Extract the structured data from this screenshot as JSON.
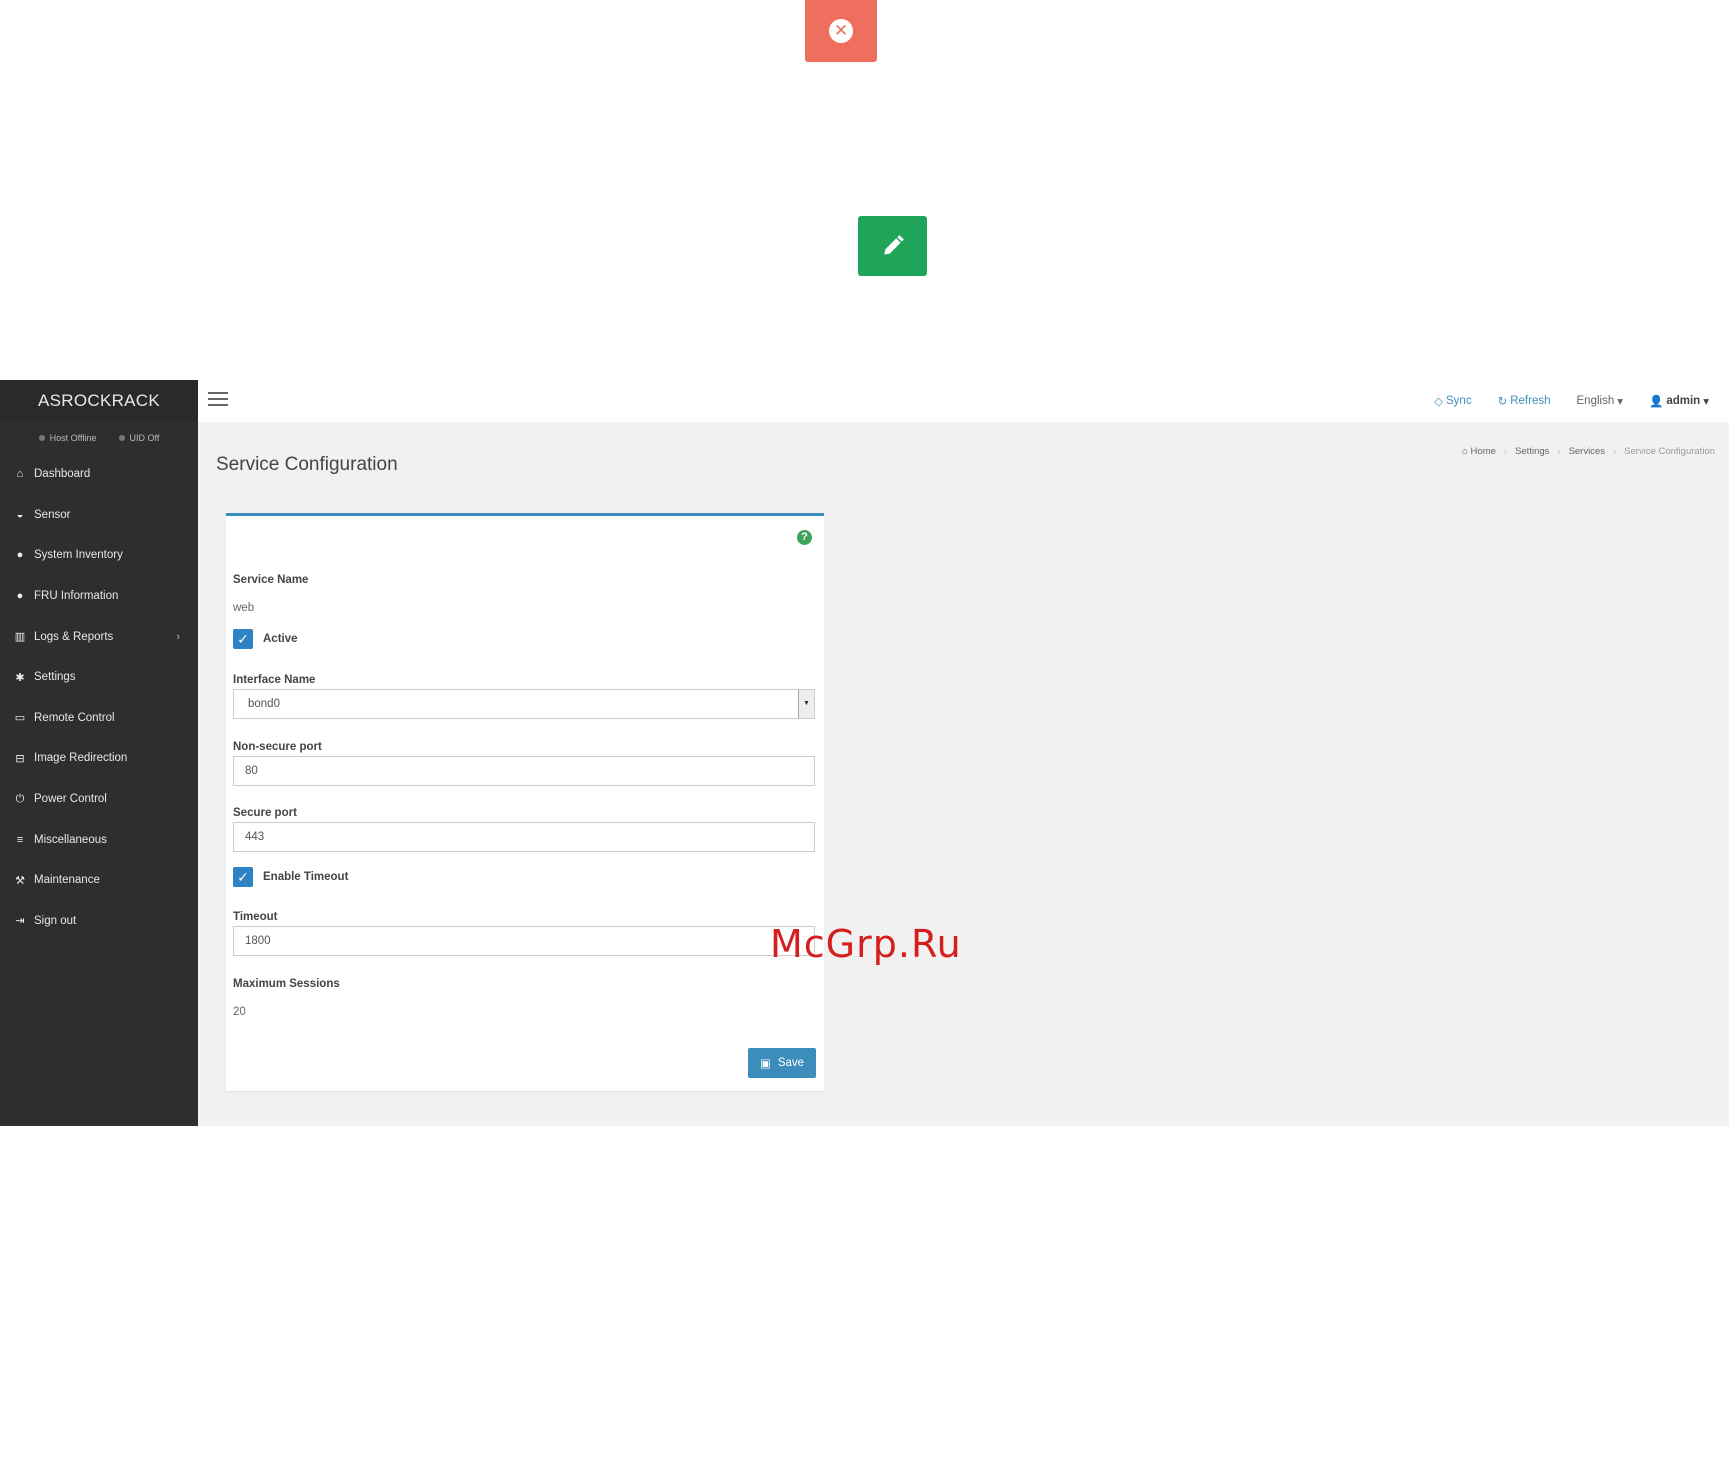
{
  "icons": {
    "delete": "delete-circle-icon",
    "edit": "pencil-icon"
  },
  "sidebar": {
    "brand": "ASROCKRACK",
    "status": [
      {
        "label": "Host Offline"
      },
      {
        "label": "UID Off"
      }
    ],
    "items": [
      {
        "label": "Dashboard",
        "icon": "home-icon"
      },
      {
        "label": "Sensor",
        "icon": "dashboard-icon"
      },
      {
        "label": "System Inventory",
        "icon": "info-icon"
      },
      {
        "label": "FRU Information",
        "icon": "info-icon"
      },
      {
        "label": "Logs & Reports",
        "icon": "bar-chart-icon"
      },
      {
        "label": "Settings",
        "icon": "gear-icon"
      },
      {
        "label": "Remote Control",
        "icon": "monitor-icon"
      },
      {
        "label": "Image Redirection",
        "icon": "disk-icon"
      },
      {
        "label": "Power Control",
        "icon": "power-icon"
      },
      {
        "label": "Miscellaneous",
        "icon": "list-icon"
      },
      {
        "label": "Maintenance",
        "icon": "wrench-icon"
      },
      {
        "label": "Sign out",
        "icon": "sign-out-icon"
      }
    ]
  },
  "topbar": {
    "sync": "Sync",
    "refresh": "Refresh",
    "language": "English",
    "user": "admin"
  },
  "page": {
    "title": "Service Configuration",
    "breadcrumb": [
      "Home",
      "Settings",
      "Services",
      "Service Configuration"
    ]
  },
  "form": {
    "service_name_label": "Service Name",
    "service_name_value": "web",
    "active_label": "Active",
    "interface_label": "Interface Name",
    "interface_value": "bond0",
    "nonsecure_label": "Non-secure port",
    "nonsecure_value": "80",
    "secure_label": "Secure port",
    "secure_value": "443",
    "enable_timeout_label": "Enable Timeout",
    "timeout_label": "Timeout",
    "timeout_value": "1800",
    "max_sessions_label": "Maximum Sessions",
    "max_sessions_value": "20",
    "save_label": "Save"
  },
  "watermark": "McGrp.Ru",
  "colors": {
    "delete": "#ef6f5e",
    "edit": "#1fa55a",
    "accent": "#3c8dbc",
    "sidebar": "#2e2e2e"
  }
}
